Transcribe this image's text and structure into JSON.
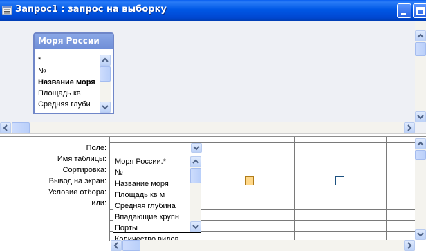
{
  "window": {
    "title": "Запрос1 : запрос на выборку"
  },
  "table_box": {
    "title": "Моря России",
    "fields": [
      "*",
      "№",
      "Название моря",
      "Площадь кв",
      "Средняя глуби"
    ]
  },
  "grid": {
    "row_labels": [
      "Поле:",
      "Имя таблицы:",
      "Сортировка:",
      "Вывод на экран:",
      "Условие отбора:",
      "или:"
    ],
    "columns": [
      {
        "field": "",
        "show": true
      },
      {
        "field": "",
        "show": false
      },
      {
        "field": "",
        "show": false
      }
    ]
  },
  "field_dropdown": {
    "options": [
      "Моря России.*",
      "№",
      "Название моря",
      "Площадь кв м",
      "Средняя глубина",
      "Впадающие крупн",
      "Порты",
      "Количество видов"
    ]
  },
  "icons": {
    "title": "query-window-icon",
    "minimize": "minimize-icon",
    "maximize": "maximize-icon",
    "close": "close-icon"
  },
  "colors": {
    "titlebar": "#0054e3",
    "table_header": "#7b97dd",
    "upper_pane": "#eef0f5"
  }
}
